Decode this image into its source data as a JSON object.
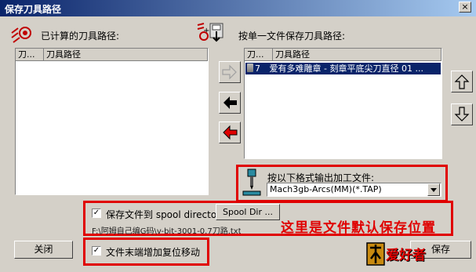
{
  "window": {
    "title": "保存刀具路径",
    "close_glyph": "×"
  },
  "left_panel": {
    "label": "已计算的刀具路径:",
    "columns": [
      "刀...",
      "刀具路径"
    ]
  },
  "right_panel": {
    "label": "按单一文件保存刀具路径:",
    "columns": [
      "刀...",
      "刀具路径"
    ],
    "rows": [
      {
        "num": "7",
        "name": "爱有多难雕章 - 刻章平底尖刀直径 01 ..."
      }
    ]
  },
  "output_format": {
    "label": "按以下格式输出加工文件:",
    "selected": "Mach3gb-Arcs(MM)(*.TAP)"
  },
  "spool": {
    "checkbox_label": "保存文件到 spool directory",
    "checked": true,
    "button_label": "Spool Dir ...",
    "path": "F:\\阿姆自己编G码\\v-bit-3001-0.7刀路.txt"
  },
  "annotation": "这里是文件默认保存位置",
  "append_home": {
    "checkbox_label": "文件末端增加复位移动",
    "checked": true
  },
  "buttons": {
    "close": "关闭",
    "save": "保存"
  },
  "logo_text": "爱好者",
  "colors": {
    "title_start": "#0a246a",
    "highlight": "#e00000",
    "selection": "#0a246a"
  }
}
